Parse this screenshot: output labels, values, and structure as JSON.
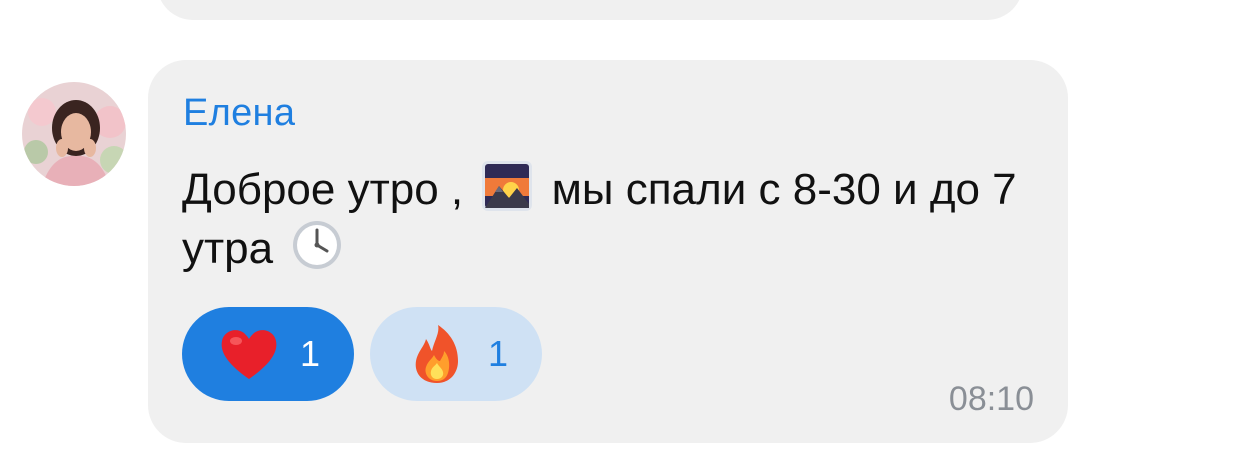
{
  "message": {
    "sender": "Елена",
    "text_part1": "Доброе утро ,",
    "emoji1": "sunrise-over-mountains-emoji",
    "text_part2": "мы спали с 8-30 и до 7 утра",
    "emoji2": "clock-emoji",
    "time": "08:10",
    "reactions": [
      {
        "icon": "heart-icon",
        "count": "1",
        "selected": true
      },
      {
        "icon": "fire-icon",
        "count": "1",
        "selected": false
      }
    ]
  },
  "colors": {
    "accent": "#1f7fe0",
    "bubble": "#f0f0f0",
    "reaction_inactive": "#cfe1f4",
    "time": "#8a8f96"
  }
}
